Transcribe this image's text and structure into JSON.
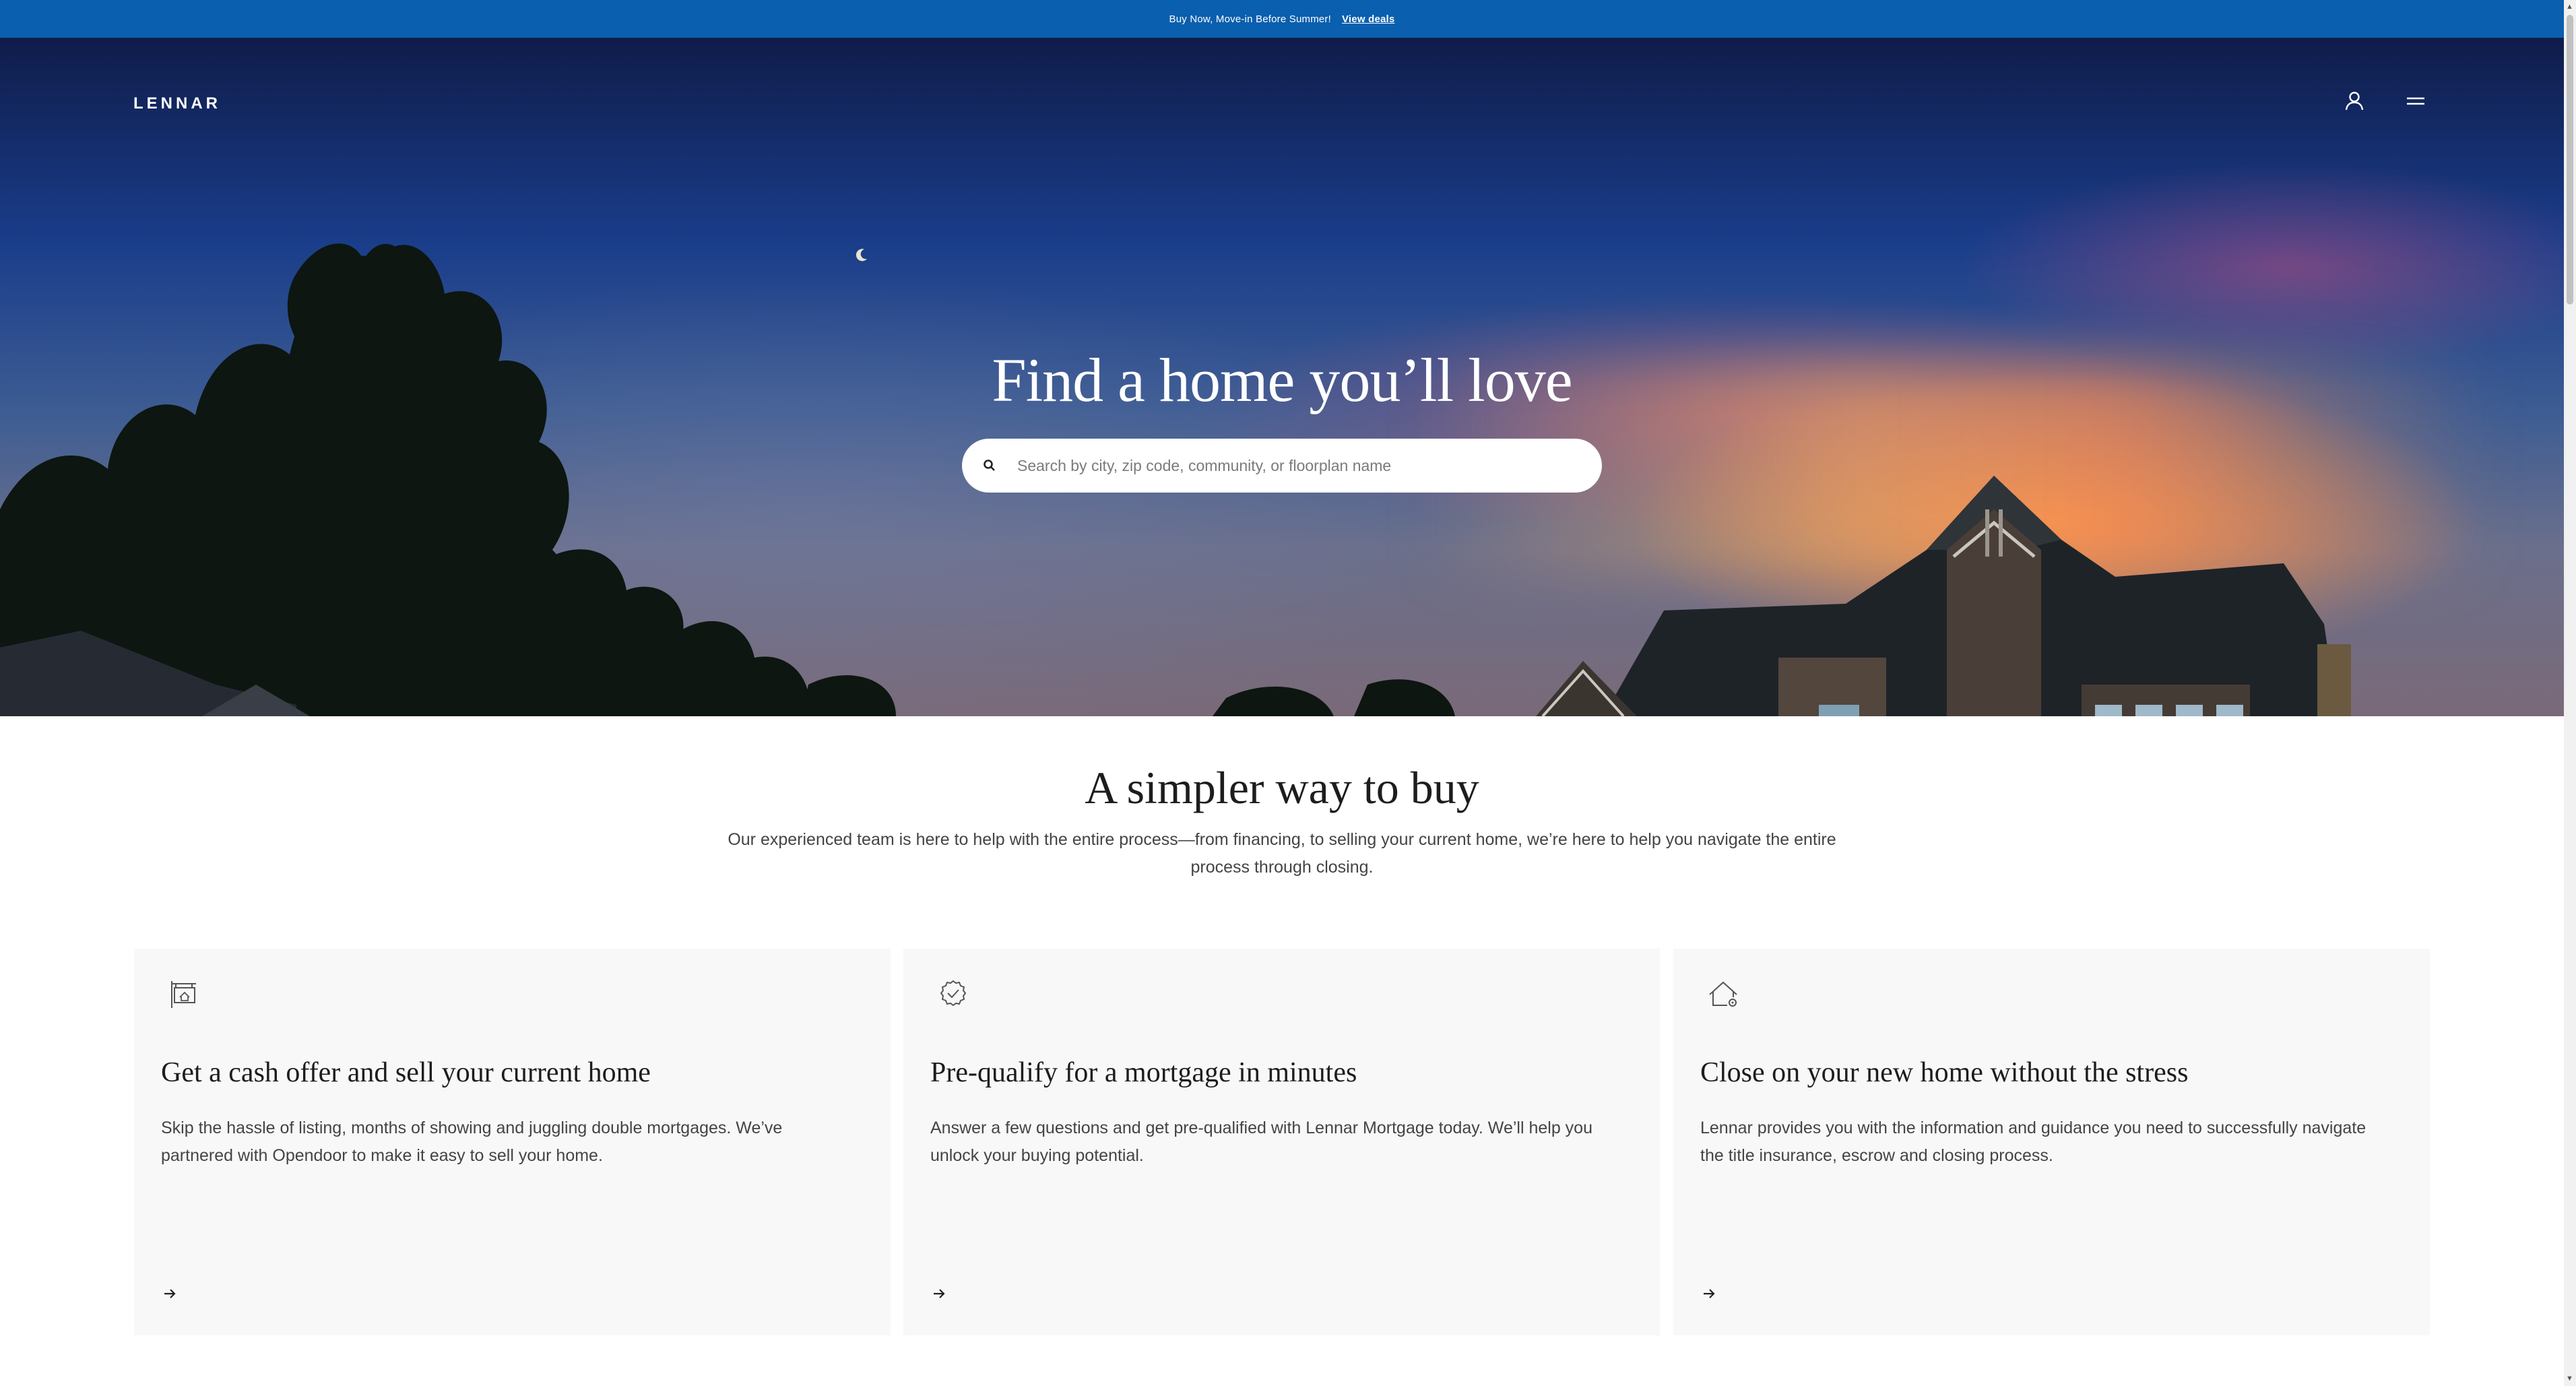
{
  "promo": {
    "text": "Buy Now, Move-in Before Summer!",
    "link": "View deals"
  },
  "header": {
    "logo": "LENNAR",
    "icons": [
      "user-icon",
      "menu-icon"
    ]
  },
  "hero": {
    "title": "Find a home you’ll love",
    "search_placeholder": "Search by city, zip code, community, or floorplan name"
  },
  "section": {
    "title": "A simpler way to buy",
    "subtitle": "Our experienced team is here to help with the entire process—from financing, to selling your current home, we’re here to help you navigate the entire process through closing.",
    "cards": [
      {
        "icon": "sign-icon",
        "title": "Get a cash offer and sell your current home",
        "body": "Skip the hassle of listing, months of showing and juggling double mortgages. We’ve partnered with Opendoor to make it easy to sell your home."
      },
      {
        "icon": "check-badge-icon",
        "title": "Pre-qualify for a mortgage in minutes",
        "body": "Answer a few questions and get pre-qualified with Lennar Mortgage today. We’ll help you unlock your buying potential."
      },
      {
        "icon": "house-key-icon",
        "title": "Close on your new home without the stress",
        "body": "Lennar provides you with the information and guidance you need to successfully navigate the title insurance, escrow and closing process."
      }
    ]
  },
  "colors": {
    "promo_bg": "#0a5fae",
    "card_bg": "#f8f8f8",
    "text_dark": "#1d1d1d"
  }
}
